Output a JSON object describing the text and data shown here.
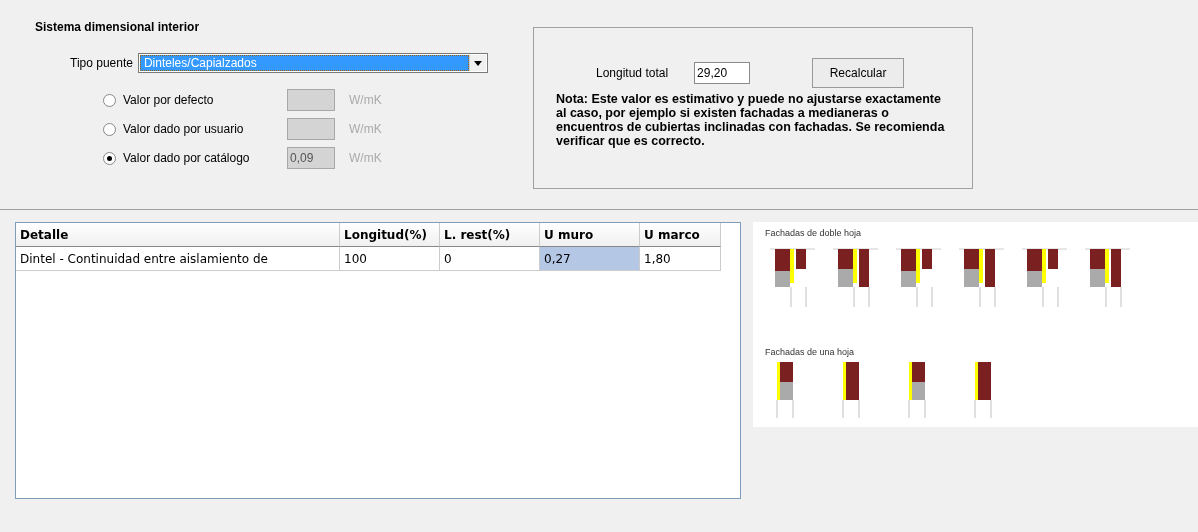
{
  "section_title": "Sistema dimensional interior",
  "bridge_type": {
    "label": "Tipo puente",
    "value": "Dinteles/Capialzados"
  },
  "value_options": [
    {
      "label": "Valor por defecto",
      "selected": false,
      "unit": "W/mK"
    },
    {
      "label": "Valor dado por usuario",
      "selected": false,
      "unit": "W/mK"
    },
    {
      "label": "Valor dado por catálogo",
      "selected": true,
      "value": "0,09",
      "unit": "W/mK"
    }
  ],
  "length_panel": {
    "label": "Longitud total",
    "value": "29,20",
    "button": "Recalcular",
    "note": "Nota: Este valor es estimativo y puede no ajustarse exactamente al caso, por ejemplo si existen fachadas a medianeras o encuentros de cubiertas inclinadas con fachadas. Se recomienda verificar que es correcto."
  },
  "table": {
    "columns": [
      "Detalle",
      "Longitud(%)",
      "L. rest(%)",
      "U muro",
      "U marco"
    ],
    "rows": [
      {
        "cells": [
          {
            "text": "Dintel - Continuidad entre aislamiento de",
            "selected": false
          },
          {
            "text": "100",
            "selected": false
          },
          {
            "text": "0",
            "selected": false
          },
          {
            "text": "0,27",
            "selected": true
          },
          {
            "text": "1,80",
            "selected": false
          }
        ]
      }
    ]
  },
  "diagram": {
    "groups": [
      {
        "title": "Fachadas de doble hoja",
        "kind": "double"
      },
      {
        "title": "Fachadas de una hoja",
        "kind": "single"
      }
    ]
  }
}
